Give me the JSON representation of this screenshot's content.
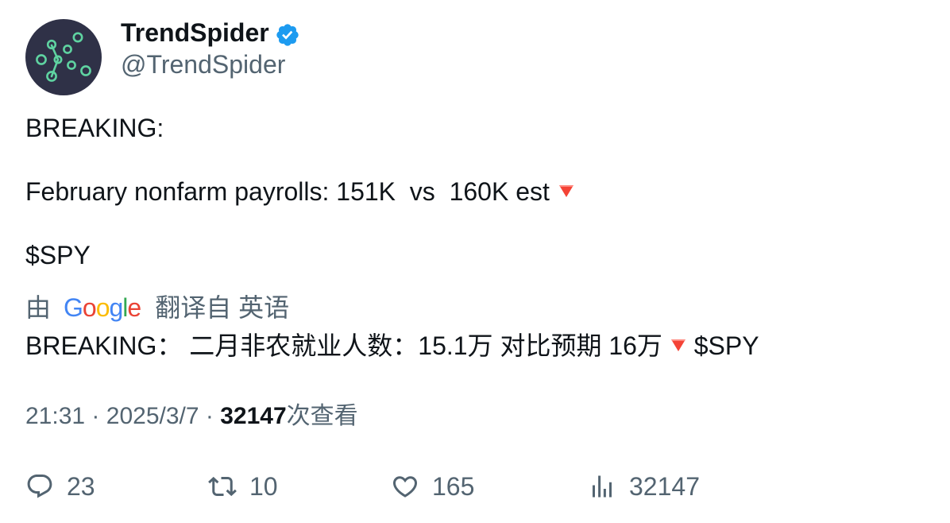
{
  "author": {
    "display_name": "TrendSpider",
    "handle": "@TrendSpider",
    "verified": true,
    "avatar_icon": "network-nodes-logo"
  },
  "tweet": {
    "line1": "BREAKING:",
    "line2_text": "February nonfarm payrolls: 151K  vs  160K est",
    "line2_icon": "red-down-triangle",
    "line3": "$SPY"
  },
  "translation": {
    "by": "由",
    "provider": "Google",
    "from_label": "翻译自 英语",
    "translated_text_a": "BREAKING： 二月非农就业人数：15.1万 对比预期 16万",
    "translated_icon": "red-down-triangle",
    "translated_text_b": "$SPY"
  },
  "meta": {
    "time": "21:31",
    "sep1": "·",
    "date": "2025/3/7",
    "sep2": "·",
    "views_count": "32147",
    "views_label": "次查看"
  },
  "actions": {
    "replies": "23",
    "retweets": "10",
    "likes": "165",
    "views": "32147"
  },
  "colors": {
    "text": "#0f1419",
    "secondary": "#536471",
    "verified": "#1d9bf0",
    "avatar_bg": "#2f3147",
    "avatar_accent": "#5fd3a1",
    "down_triangle": "#f44336"
  }
}
